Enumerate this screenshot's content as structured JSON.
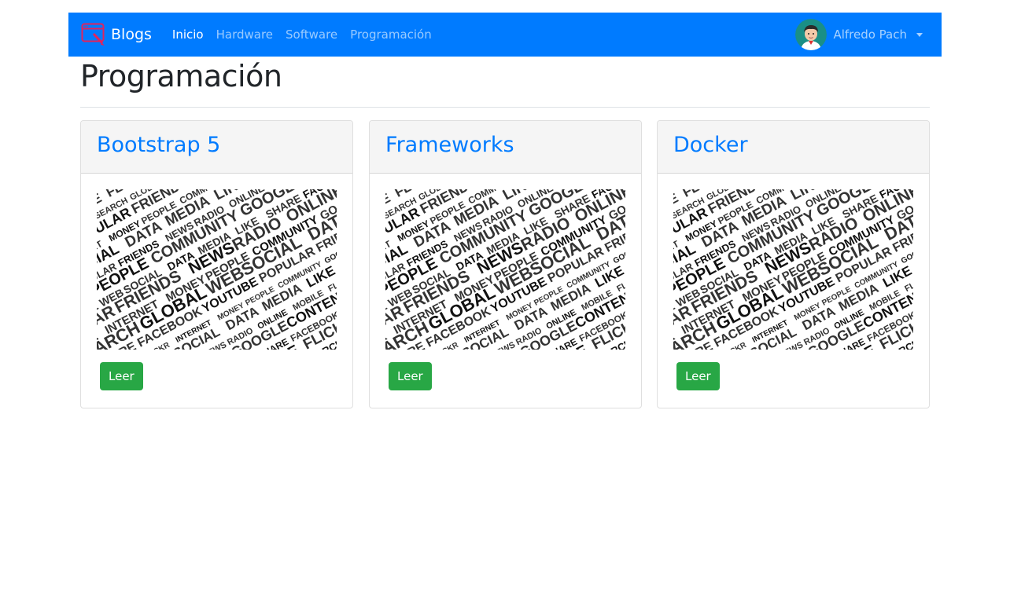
{
  "navbar": {
    "brand": "Blogs",
    "links": [
      {
        "label": "Inicio",
        "active": true
      },
      {
        "label": "Hardware",
        "active": false
      },
      {
        "label": "Software",
        "active": false
      },
      {
        "label": "Programación",
        "active": false
      }
    ],
    "user_name": "Alfredo Pach",
    "colors": {
      "bg": "#007bff"
    }
  },
  "page": {
    "title": "Programación"
  },
  "cards": [
    {
      "title": "Bootstrap 5",
      "button": "Leer"
    },
    {
      "title": "Frameworks",
      "button": "Leer"
    },
    {
      "title": "Docker",
      "button": "Leer"
    }
  ],
  "image_words": [
    "WEB",
    "SOCIAL",
    "DATA",
    "MEDIA",
    "LIKE",
    "SHARE",
    "FACEBOOK",
    "YOUTUBE",
    "POPULAR",
    "FRIENDS",
    "NEWS",
    "RADIO",
    "ONLINE",
    "MOBILE",
    "FLICKR",
    "INTERNET",
    "MONEY",
    "PEOPLE",
    "COMMUNITY",
    "GOOGLE",
    "CONTENT",
    "SEARCH",
    "GLOBAL"
  ],
  "colors": {
    "accent": "#007bff",
    "button": "#28a745",
    "header_bg": "#f5f5f5"
  }
}
